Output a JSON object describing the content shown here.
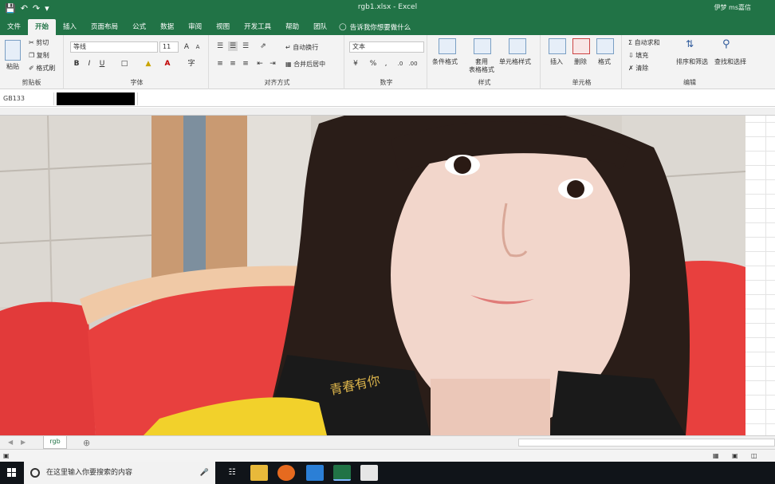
{
  "window": {
    "title": "rgb1.xlsx  -  Excel",
    "user": "伊梦 ms嘉信"
  },
  "ribbon_tabs": [
    "文件",
    "开始",
    "插入",
    "页面布局",
    "公式",
    "数据",
    "审阅",
    "视图",
    "开发工具",
    "帮助",
    "团队"
  ],
  "tell_me": "告诉我你想要做什么",
  "clipboard": {
    "paste": "粘贴",
    "cut": "剪切",
    "copy": "复制",
    "format_painter": "格式刷",
    "label": "剪贴板"
  },
  "font": {
    "name": "等线",
    "size": "11",
    "label": "字体"
  },
  "alignment": {
    "wrap": "自动换行",
    "merge": "合并后居中",
    "label": "对齐方式"
  },
  "number": {
    "format": "文本",
    "label": "数字"
  },
  "styles": {
    "conditional": "条件格式",
    "table1": "套用",
    "table2": "表格格式",
    "cell_styles": "单元格样式",
    "label": "样式"
  },
  "cells": {
    "insert": "插入",
    "delete": "删除",
    "format": "格式",
    "label": "单元格"
  },
  "editing": {
    "autosum": "自动求和",
    "fill": "填充",
    "clear": "清除",
    "sort": "排序和筛选",
    "find": "查找和选择",
    "label": "编辑"
  },
  "formula_bar": {
    "name_box": "GB133"
  },
  "sheet_tabs": [
    "rgb"
  ],
  "taskbar": {
    "search_placeholder": "在这里输入你要搜索的内容"
  },
  "photo_badge": "青春有你"
}
